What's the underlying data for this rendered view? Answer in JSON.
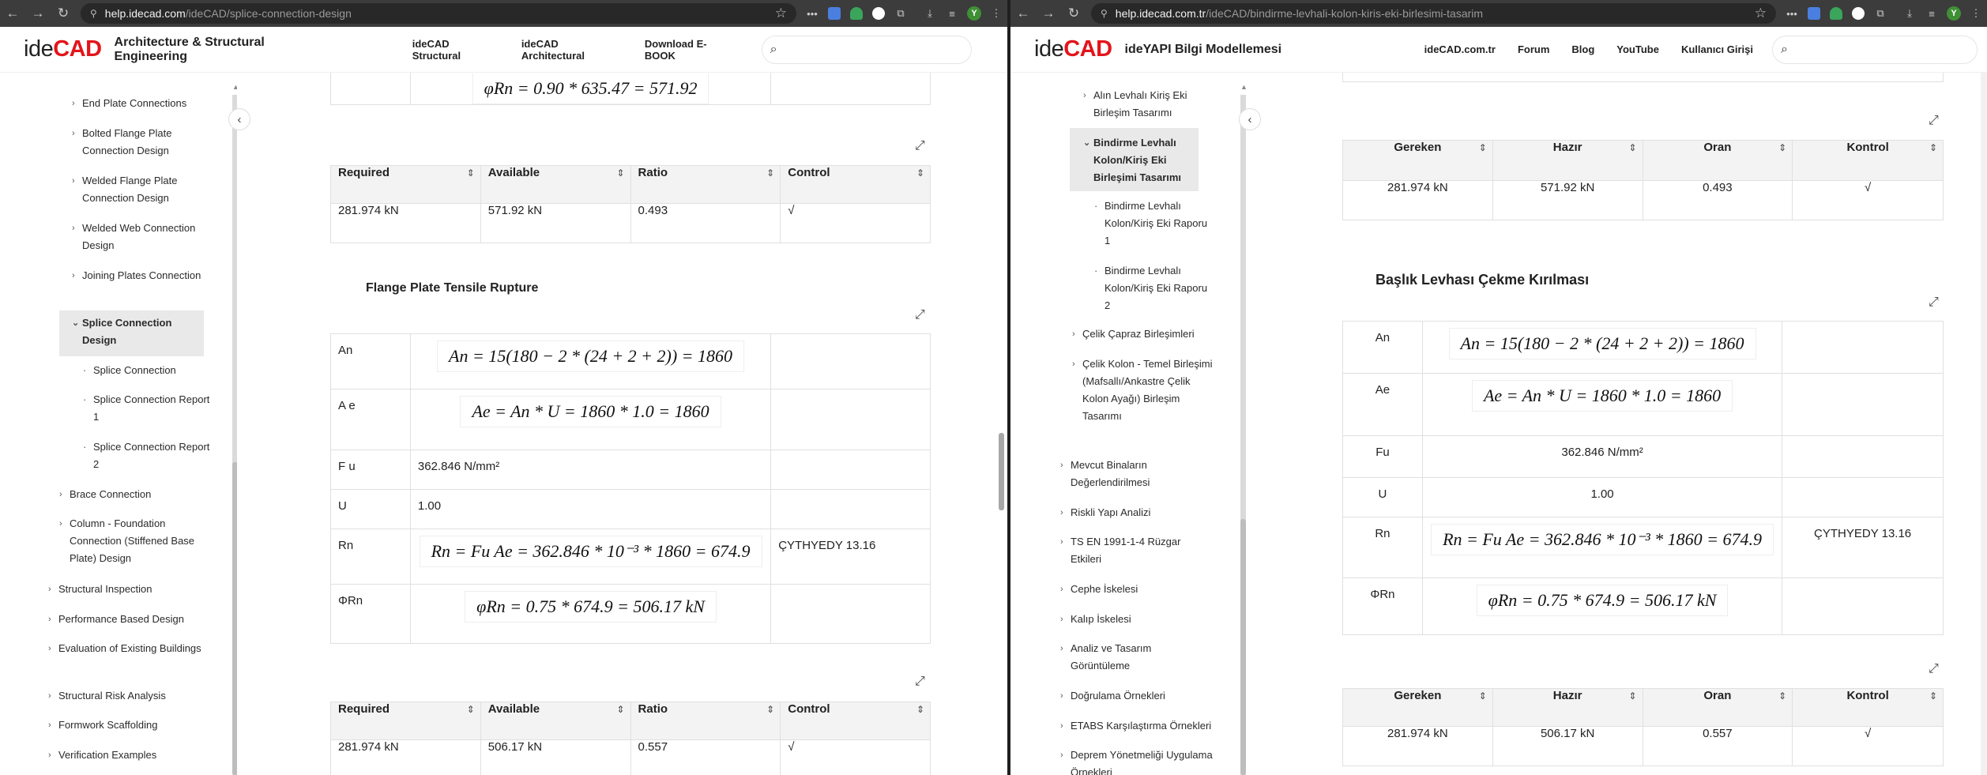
{
  "left": {
    "url_host": "help.idecad.com",
    "url_path": "/ideCAD/splice-connection-design",
    "logo_ide": "ide",
    "logo_cad": "CAD",
    "site_title": "Architecture & Structural Engineering",
    "nav": [
      "ideCAD Structural",
      "ideCAD Architectural",
      "Download E-BOOK"
    ],
    "sidebar": [
      {
        "label": "End Plate Connections",
        "marker": "›"
      },
      {
        "label": "Bolted Flange Plate Connection Design",
        "marker": "›"
      },
      {
        "label": "Welded Flange Plate Connection Design",
        "marker": "›"
      },
      {
        "label": "Welded Web Connection Design",
        "marker": "›"
      },
      {
        "label": "Joining Plates Connection",
        "marker": "›"
      },
      {
        "label": "Splice Connection Design",
        "marker": "⌄"
      },
      {
        "label": "Splice Connection",
        "marker": "·"
      },
      {
        "label": "Splice Connection Report 1",
        "marker": "·"
      },
      {
        "label": "Splice Connection Report 2",
        "marker": "·"
      },
      {
        "label": "Brace Connection",
        "marker": "›"
      },
      {
        "label": "Column - Foundation Connection (Stiffened Base Plate) Design",
        "marker": "›"
      },
      {
        "label": "Structural Inspection",
        "marker": "›"
      },
      {
        "label": "Performance Based Design",
        "marker": "›"
      },
      {
        "label": "Evaluation of Existing Buildings",
        "marker": "›"
      },
      {
        "label": "Structural Risk Analysis",
        "marker": "›"
      },
      {
        "label": "Formwork Scaffolding",
        "marker": "›"
      },
      {
        "label": "Verification Examples",
        "marker": "›"
      }
    ],
    "top_partial_formula": "φRn = 0.90 * 635.47 = 571.92",
    "check_headers": [
      "Required",
      "Available",
      "Ratio",
      "Control"
    ],
    "check1": [
      "281.974 kN",
      "571.92 kN",
      "0.493",
      "√"
    ],
    "section_title": "Flange Plate Tensile Rupture",
    "rows": [
      {
        "label": "An",
        "formula": "An = 15(180 − 2 * (24 + 2 + 2)) = 1860",
        "ref": ""
      },
      {
        "label": "A e",
        "formula": "Ae = An * U = 1860 * 1.0 = 1860",
        "ref": ""
      },
      {
        "label": "F u",
        "value": "362.846 N/mm²",
        "ref": ""
      },
      {
        "label": "U",
        "value": "1.00",
        "ref": ""
      },
      {
        "label": "Rn",
        "formula": "Rn = Fu Ae = 362.846 * 10⁻³ * 1860 = 674.9",
        "ref": "ÇYTHYEDY 13.16"
      },
      {
        "label": "ΦRn",
        "formula": "φRn = 0.75 * 674.9 = 506.17 kN",
        "ref": ""
      }
    ],
    "check2": [
      "281.974 kN",
      "506.17 kN",
      "0.557",
      "√"
    ]
  },
  "right": {
    "url_host": "help.idecad.com.tr",
    "url_path": "/ideCAD/bindirme-levhali-kolon-kiris-eki-birlesimi-tasarim",
    "logo_ide": "ide",
    "logo_cad": "CAD",
    "site_title": "ideYAPI Bilgi Modellemesi",
    "nav": [
      "ideCAD.com.tr",
      "Forum",
      "Blog",
      "YouTube",
      "Kullanıcı Girişi"
    ],
    "sidebar": [
      {
        "label": "Alın Levhalı Kiriş Eki Birleşim Tasarımı",
        "marker": "›"
      },
      {
        "label": "Bindirme Levhalı Kolon/Kiriş Eki Birleşimi Tasarımı",
        "marker": "⌄"
      },
      {
        "label": "Bindirme Levhalı Kolon/Kiriş Eki Raporu 1",
        "marker": "·"
      },
      {
        "label": "Bindirme Levhalı Kolon/Kiriş Eki Raporu 2",
        "marker": "·"
      },
      {
        "label": "Çelik Çapraz Birleşimleri",
        "marker": "›"
      },
      {
        "label": "Çelik Kolon - Temel Birleşimi (Mafsallı/Ankastre Çelik Kolon Ayağı) Birleşim Tasarımı",
        "marker": "›"
      },
      {
        "label": "Mevcut Binaların Değerlendirilmesi",
        "marker": "›"
      },
      {
        "label": "Riskli Yapı Analizi",
        "marker": "›"
      },
      {
        "label": "TS EN 1991-1-4 Rüzgar Etkileri",
        "marker": "›"
      },
      {
        "label": "Cephe İskelesi",
        "marker": "›"
      },
      {
        "label": "Kalıp İskelesi",
        "marker": "›"
      },
      {
        "label": "Analiz ve Tasarım Görüntüleme",
        "marker": "›"
      },
      {
        "label": "Doğrulama Örnekleri",
        "marker": "›"
      },
      {
        "label": "ETABS Karşılaştırma Örnekleri",
        "marker": "›"
      },
      {
        "label": "Deprem Yönetmeliği Uygulama Örnekleri",
        "marker": "›"
      }
    ],
    "check_headers": [
      "Gereken",
      "Hazır",
      "Oran",
      "Kontrol"
    ],
    "check1": [
      "281.974 kN",
      "571.92 kN",
      "0.493",
      "√"
    ],
    "section_title": "Başlık Levhası Çekme Kırılması",
    "rows": [
      {
        "label": "An",
        "formula": "An = 15(180 − 2 * (24 + 2 + 2)) = 1860",
        "ref": ""
      },
      {
        "label": "Ae",
        "formula": "Ae = An * U = 1860 * 1.0 = 1860",
        "ref": ""
      },
      {
        "label": "Fu",
        "value": "362.846 N/mm²",
        "ref": ""
      },
      {
        "label": "U",
        "value": "1.00",
        "ref": ""
      },
      {
        "label": "Rn",
        "formula": "Rn = Fu Ae = 362.846 * 10⁻³ * 1860 = 674.9",
        "ref": "ÇYTHYEDY 13.16"
      },
      {
        "label": "ΦRn",
        "formula": "φRn = 0.75 * 674.9 = 506.17 kN",
        "ref": ""
      }
    ],
    "check2": [
      "281.974 kN",
      "506.17 kN",
      "0.557",
      "√"
    ]
  },
  "browser": {
    "profile_initial": "Y"
  },
  "colors": {
    "brand_red": "#e3141b",
    "chrome_bg": "#3c3c3c",
    "header_cell_bg": "#f3f3f3"
  }
}
